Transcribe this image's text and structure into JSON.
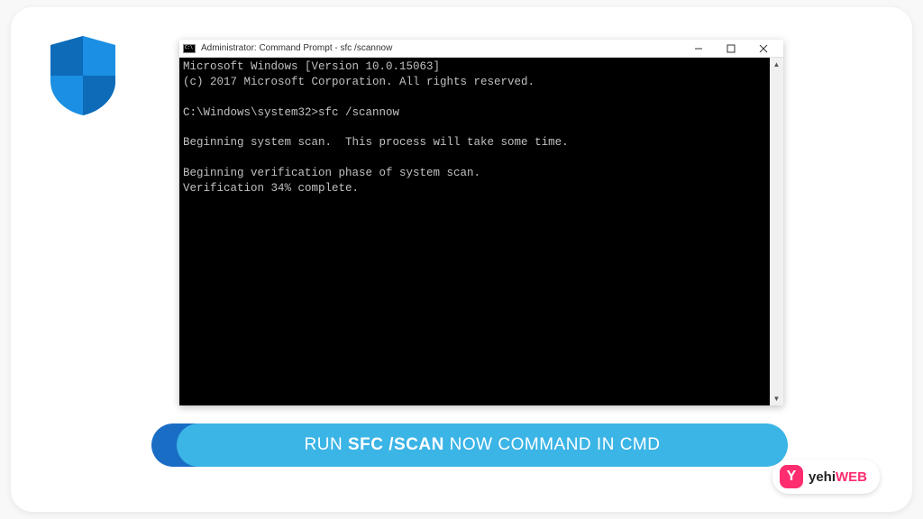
{
  "titlebar": {
    "title": "Administrator: Command Prompt - sfc  /scannow"
  },
  "terminal": {
    "line1": "Microsoft Windows [Version 10.0.15063]",
    "line2": "(c) 2017 Microsoft Corporation. All rights reserved.",
    "prompt": "C:\\Windows\\system32>",
    "command": "sfc /scannow",
    "line4": "Beginning system scan.  This process will take some time.",
    "line5": "Beginning verification phase of system scan.",
    "line6": "Verification 34% complete."
  },
  "banner": {
    "pre": "RUN ",
    "strong": "SFC /SCAN",
    "post": " NOW COMMAND IN CMD"
  },
  "logo": {
    "badge": "Y",
    "word1": "yehi",
    "word2": "WEB"
  }
}
